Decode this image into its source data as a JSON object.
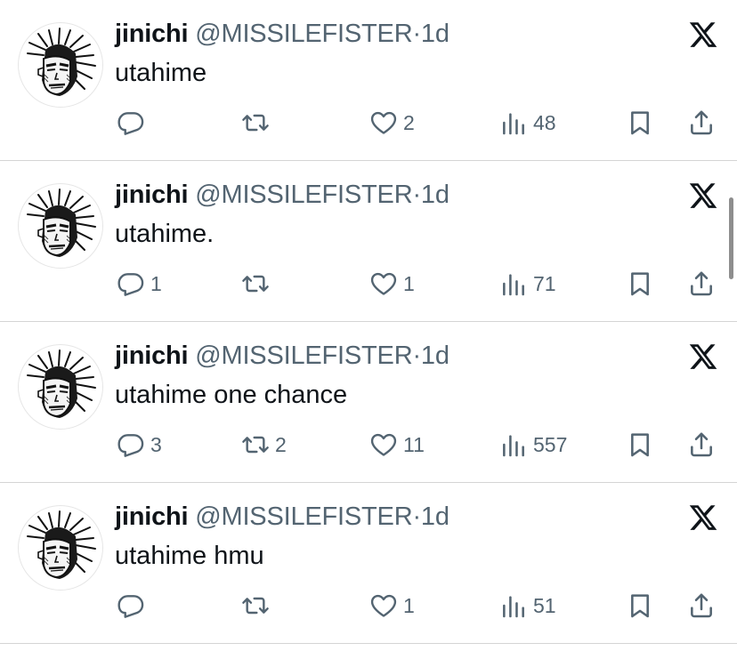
{
  "tweets": [
    {
      "name": "jinichi",
      "handle": "@MISSILEFISTER",
      "separator": "·",
      "time": "1d",
      "text": "utahime",
      "replies": "",
      "retweets": "",
      "likes": "2",
      "views": "48"
    },
    {
      "name": "jinichi",
      "handle": "@MISSILEFISTER",
      "separator": "·",
      "time": "1d",
      "text": "utahime.",
      "replies": "1",
      "retweets": "",
      "likes": "1",
      "views": "71"
    },
    {
      "name": "jinichi",
      "handle": "@MISSILEFISTER",
      "separator": "·",
      "time": "1d",
      "text": "utahime one chance",
      "replies": "3",
      "retweets": "2",
      "likes": "11",
      "views": "557"
    },
    {
      "name": "jinichi",
      "handle": "@MISSILEFISTER",
      "separator": "·",
      "time": "1d",
      "text": "utahime hmu",
      "replies": "",
      "retweets": "",
      "likes": "1",
      "views": "51"
    }
  ],
  "icons": {
    "logo": "x-logo-icon",
    "reply": "reply-icon",
    "retweet": "retweet-icon",
    "like": "heart-icon",
    "views": "views-icon",
    "bookmark": "bookmark-icon",
    "share": "share-icon",
    "avatar": "avatar-image"
  },
  "colors": {
    "text_primary": "#0f1419",
    "text_secondary": "#536471",
    "divider": "#d4d4d4",
    "background": "#ffffff"
  }
}
